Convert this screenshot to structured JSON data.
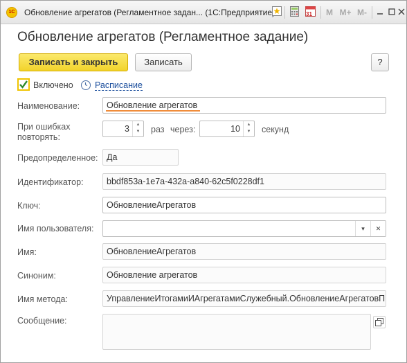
{
  "window": {
    "title": "Обновление агрегатов (Регламентное задан... (1С:Предприятие)",
    "app_logo": "1С",
    "toolbar_icons": [
      "favorites-icon",
      "calculator-icon",
      "calendar-icon",
      "memory-m-icon",
      "memory-mplus-icon",
      "memory-mminus-icon",
      "minimize-icon",
      "maximize-icon",
      "close-icon"
    ],
    "calendar_day": "31",
    "m_label": "M",
    "mplus_label": "M+",
    "mminus_label": "M-"
  },
  "form": {
    "heading": "Обновление агрегатов (Регламентное задание)",
    "buttons": {
      "save_close": "Записать и закрыть",
      "save": "Записать",
      "help": "?"
    },
    "enabled": {
      "label": "Включено",
      "checked": true
    },
    "schedule_link": "Расписание",
    "fields": {
      "name": {
        "label": "Наименование:",
        "value": "Обновление агрегатов"
      },
      "retry": {
        "label": "При ошибках повторять:",
        "count": "3",
        "times_label": "раз",
        "via_label": "через:",
        "interval": "10",
        "seconds_label": "секунд"
      },
      "predefined": {
        "label": "Предопределенное:",
        "value": "Да"
      },
      "identifier": {
        "label": "Идентификатор:",
        "value": "bbdf853a-1e7a-432a-a840-62c5f0228df1"
      },
      "key": {
        "label": "Ключ:",
        "value": "ОбновлениеАгрегатов"
      },
      "user_name": {
        "label": "Имя пользователя:",
        "value": ""
      },
      "name_field": {
        "label": "Имя:",
        "value": "ОбновлениеАгрегатов"
      },
      "synonym": {
        "label": "Синоним:",
        "value": "Обновление агрегатов"
      },
      "method": {
        "label": "Имя метода:",
        "value": "УправлениеИтогамиИАгрегатамиСлужебный.ОбновлениеАгрегатовП"
      },
      "message": {
        "label": "Сообщение:",
        "value": ""
      }
    }
  },
  "colors": {
    "primary_button": "#f2d32b",
    "link": "#1a4d9c",
    "focus_underline": "#f08c3a",
    "checkbox_border": "#f0c400",
    "checkmark": "#2e8b2e"
  }
}
